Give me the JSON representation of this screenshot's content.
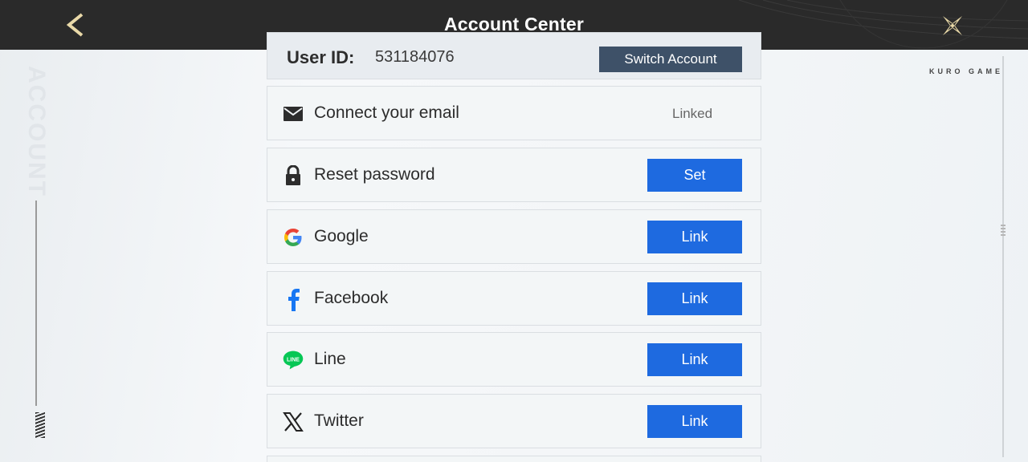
{
  "header": {
    "title": "Account Center",
    "back_icon": "chevron-left-icon",
    "close_icon": "close-x-icon"
  },
  "side": {
    "vertical_text": "ACCOUNT",
    "brand": "KURO GAME"
  },
  "account": {
    "user_id_label": "User ID:",
    "user_id_value": "531184076",
    "switch_label": "Switch Account"
  },
  "rows": [
    {
      "icon": "mail-icon",
      "label": "Connect your email",
      "status": "Linked"
    },
    {
      "icon": "lock-icon",
      "label": "Reset password",
      "button": "Set"
    },
    {
      "icon": "google-icon",
      "label": "Google",
      "button": "Link"
    },
    {
      "icon": "facebook-icon",
      "label": "Facebook",
      "button": "Link"
    },
    {
      "icon": "line-icon",
      "label": "Line",
      "button": "Link"
    },
    {
      "icon": "x-twitter-icon",
      "label": "Twitter",
      "button": "Link"
    }
  ],
  "colors": {
    "header_bg": "#2a2a2a",
    "link_button": "#1e6ae0",
    "switch_button": "#3e5168",
    "accent_gold": "#e9d9a8"
  }
}
